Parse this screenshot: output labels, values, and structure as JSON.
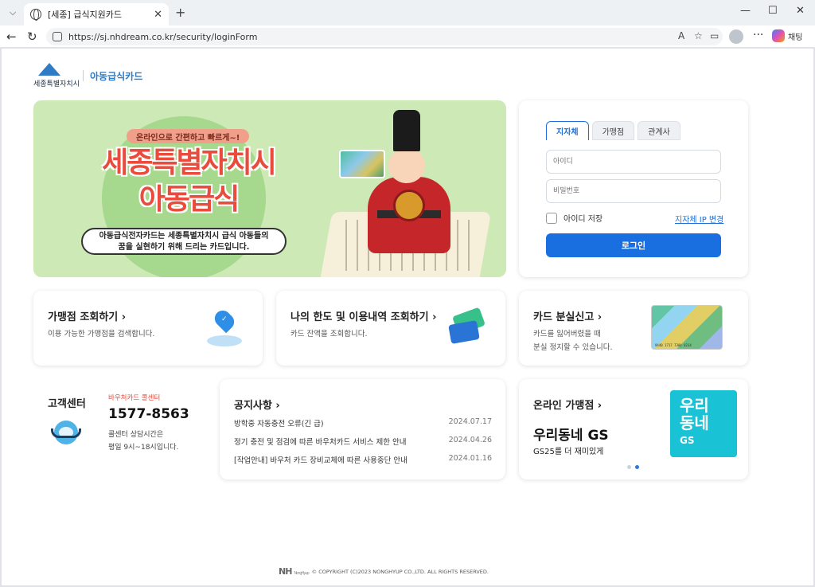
{
  "browser": {
    "tab_title": "[세종] 급식지원카드",
    "url": "https://sj.nhdream.co.kr/security/loginForm",
    "copilot_label": "채팅"
  },
  "brand": {
    "city": "세종특별자치시",
    "product": "아동급식카드"
  },
  "banner": {
    "pill": "온라인으로 간편하고 빠르게~!",
    "headline_1": "세종특별자치시",
    "headline_2": "아동급식",
    "desc_1": "아동급식전자카드는 세종특별자치시 급식 아동들의",
    "desc_2": "꿈을 실현하기 위해 드리는 카드입니다."
  },
  "login": {
    "tabs": [
      "지자체",
      "가맹점",
      "관계사"
    ],
    "id_placeholder": "아이디",
    "pw_placeholder": "비밀번호",
    "save_id": "아이디 저장",
    "ip_change": "지자체 IP 변경",
    "login_button": "로그인"
  },
  "cards": {
    "store": {
      "title": "가맹점 조회하기 ›",
      "desc": "이용 가능한 가맹점을 검색합니다."
    },
    "limit": {
      "title": "나의 한도 및 이용내역 조회하기 ›",
      "desc": "카드 잔액을 조회합니다."
    },
    "lost": {
      "title": "카드 분실신고 ›",
      "desc_1": "카드를 잃어버렸을 때",
      "desc_2": "분실 정지할 수 있습니다."
    }
  },
  "customer_center": {
    "title": "고객센터",
    "label": "바우처카드 콜센터",
    "phone": "1577-8563",
    "hours_1": "콜센터 상담시간은",
    "hours_2": "평일 9시~18시입니다."
  },
  "notice": {
    "title": "공지사항 ›",
    "items": [
      {
        "text": "방학중 자동충전 오류(긴 급)",
        "date": "2024.07.17"
      },
      {
        "text": "정기 충전 및 점검에 따른 바우처카드 서비스 제한 안내",
        "date": "2024.04.26"
      },
      {
        "text": "[작업안내] 바우처 카드 장비교체에 따른 사용중단 안내",
        "date": "2024.01.16"
      }
    ]
  },
  "online": {
    "title": "온라인 가맹점 ›",
    "headline": "우리동네 GS",
    "sub": "GS25를 더 재미있게",
    "gs_line1": "우리",
    "gs_line2": "동네",
    "gs_line3": "GS"
  },
  "footer": {
    "logo": "NH",
    "logo_small": "NongHyup",
    "copyright": "© COPYRIGHT (C)2023 NONGHYUP CO.,LTD. ALL RIGHTS RESERVED."
  }
}
